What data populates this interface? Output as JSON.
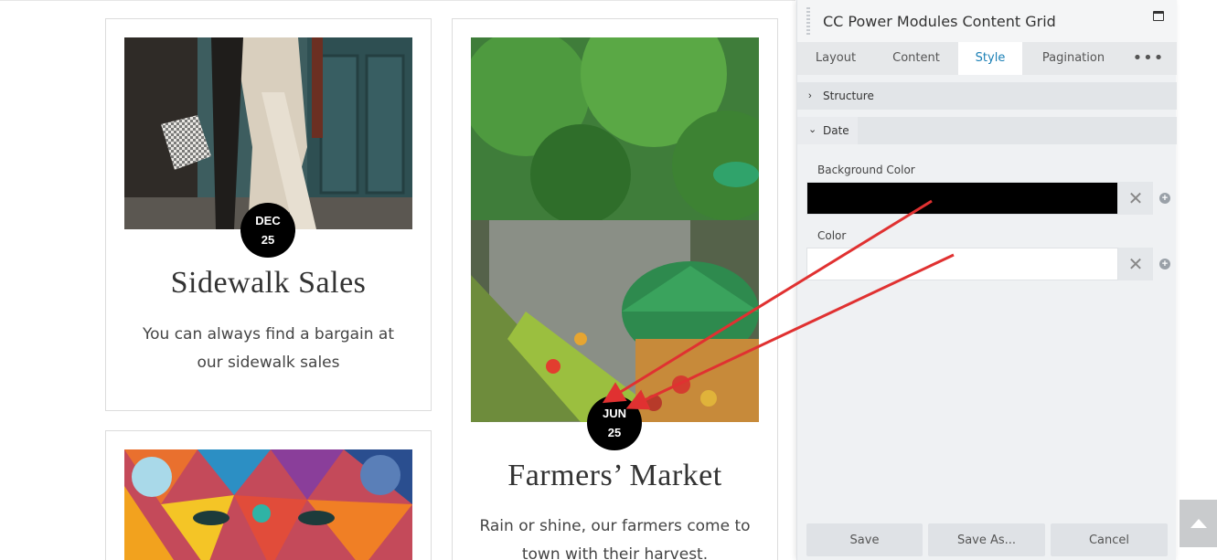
{
  "cards": [
    {
      "date_month": "DEC",
      "date_day": "25",
      "title": "Sidewalk Sales",
      "excerpt_line1": "You can always find a bargain at",
      "excerpt_line2": "our sidewalk sales"
    },
    {
      "date_month": "JUN",
      "date_day": "25",
      "title": "Farmers’ Market",
      "excerpt_line1": "Rain or shine, our farmers come to",
      "excerpt_line2": "town with their harvest."
    }
  ],
  "panel": {
    "title": "CC Power Modules Content Grid",
    "tabs": [
      {
        "label": "Layout",
        "active": false
      },
      {
        "label": "Content",
        "active": false
      },
      {
        "label": "Style",
        "active": true
      },
      {
        "label": "Pagination",
        "active": false
      }
    ],
    "more_label": "•••",
    "sections": {
      "structure": "Structure",
      "date": "Date"
    },
    "fields": {
      "background_color_label": "Background Color",
      "background_color_value": "#000000",
      "color_label": "Color",
      "color_value": "#ffffff"
    },
    "buttons": {
      "save": "Save",
      "save_as": "Save As...",
      "cancel": "Cancel"
    }
  },
  "colors": {
    "accent": "#1a7fb5",
    "annotation_arrow": "#e03131",
    "badge_bg": "#000000"
  }
}
